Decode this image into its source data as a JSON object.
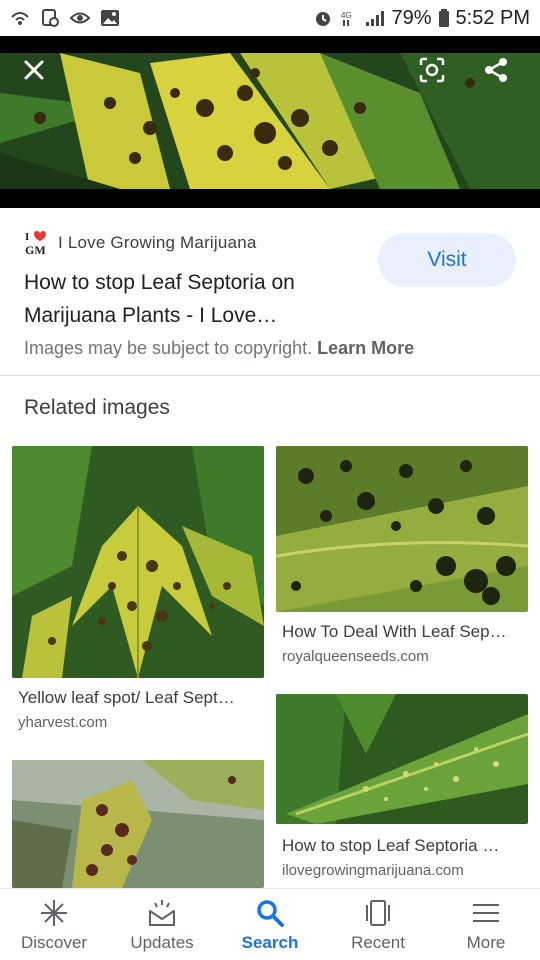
{
  "status_bar": {
    "battery": "79%",
    "time": "5:52 PM"
  },
  "hero": {
    "close_icon": "close-icon",
    "lens_icon": "lens-icon",
    "share_icon": "share-icon"
  },
  "source": {
    "logo_text": "GM",
    "site_name": "I Love Growing Marijuana",
    "title": "How to stop Leaf Septoria on Marijuana Plants - I Love…",
    "visit_label": "Visit",
    "copyright_text": "Images may be subject to copyright.",
    "learn_more": "Learn More"
  },
  "related": {
    "heading": "Related images",
    "items": [
      {
        "caption": "Yellow leaf spot/ Leaf Sept…",
        "domain": "yharvest.com"
      },
      {
        "caption": "How To Deal With Leaf Sep…",
        "domain": "royalqueenseeds.com"
      },
      {
        "caption": "How to stop Leaf Septoria …",
        "domain": "ilovegrowingmarijuana.com"
      },
      {
        "caption": "",
        "domain": ""
      }
    ]
  },
  "bottom_nav": {
    "items": [
      {
        "label": "Discover",
        "icon": "asterisk-icon",
        "active": false
      },
      {
        "label": "Updates",
        "icon": "inbox-icon",
        "active": false
      },
      {
        "label": "Search",
        "icon": "search-icon",
        "active": true
      },
      {
        "label": "Recent",
        "icon": "recent-icon",
        "active": false
      },
      {
        "label": "More",
        "icon": "menu-icon",
        "active": false
      }
    ]
  },
  "colors": {
    "accent": "#1a73e8",
    "visit_bg": "#e8f0fe",
    "leaf_yellow": "#d9d23a",
    "leaf_green": "#3f7a2a"
  }
}
